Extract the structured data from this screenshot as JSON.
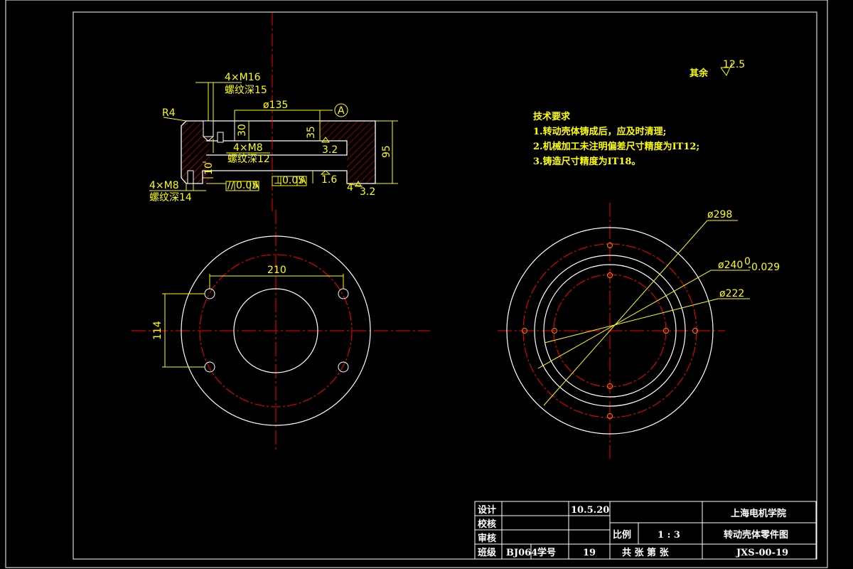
{
  "roughness_note": {
    "label": "其余",
    "value": "12.5"
  },
  "tech_requirements": {
    "title": "技术要求",
    "items": [
      "1.转动壳体铸成后，应及时清理;",
      "2.机械加工未注明偏差尺寸精度为IT12;",
      "3.铸造尺寸精度为IT18。"
    ]
  },
  "section_view": {
    "r4": "R4",
    "m16": "4×M16",
    "m16_depth": "螺纹深15",
    "m8_top": "4×M8",
    "m8_top_depth": "螺纹深12",
    "m8_bottom": "4×M8",
    "m8_bottom_depth": "螺纹深14",
    "dia135": "ø135",
    "datum": "A",
    "dim30": "30",
    "dim95": "95",
    "dim10": "10",
    "dim35": "35",
    "dim4": "4",
    "rough_32a": "3.2",
    "rough_16": "1.6",
    "rough_32b": "3.2",
    "tol_parallel": {
      "symbol": "//",
      "value": "0.05",
      "datum": "A"
    },
    "tol_perp": {
      "symbol": "⊥",
      "value": "0.05",
      "datum": "A"
    }
  },
  "left_view": {
    "dim210": "210",
    "dim114": "114"
  },
  "right_view": {
    "dia298": "ø298",
    "dia240": "ø240",
    "dia240_tol_upper": "0",
    "dia240_tol_lower": "-0.029",
    "dia222": "ø222"
  },
  "title_block": {
    "design_label": "设计",
    "design_date": "10.5.20",
    "check_label": "校核",
    "review_label": "审核",
    "class_label": "班级",
    "class_value": "BJ064",
    "student_no_label": "学号",
    "student_no_value": "19",
    "scale_label": "比例",
    "scale_value": "1 : 3",
    "sheets_text": "共  张  第  张",
    "school": "上海电机学院",
    "drawing_name": "转动壳体零件图",
    "drawing_no": "JXS-00-19"
  },
  "colors": {
    "outline": "#ffffff",
    "dimension": "#ffff00",
    "centerline": "#ff0000",
    "hatch": "#ff0000"
  }
}
